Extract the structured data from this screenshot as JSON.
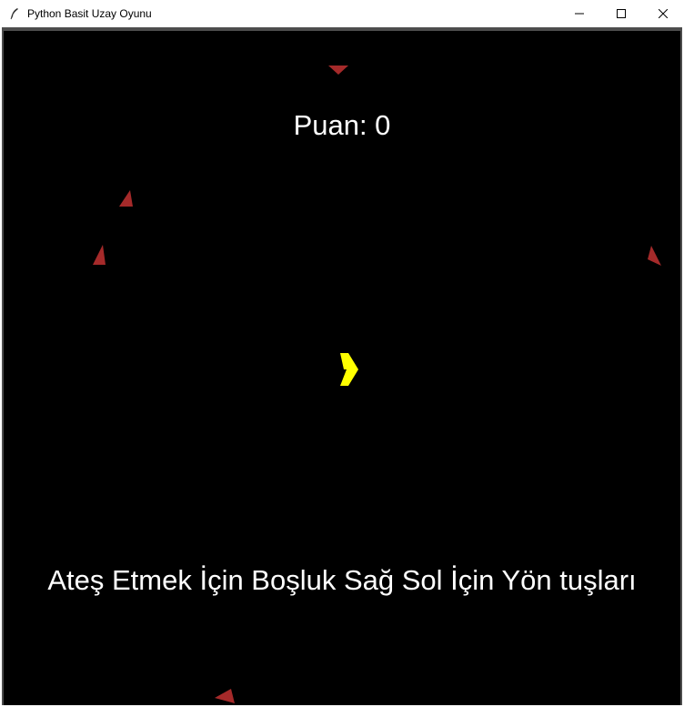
{
  "window": {
    "title": "Python Basit Uzay Oyunu",
    "icon": "feather-icon",
    "controls": [
      "minimize-icon",
      "maximize-icon",
      "close-icon"
    ]
  },
  "game": {
    "score_text": "Puan: 0",
    "instructions": "Ateş Etmek İçin Boşluk Sağ Sol İçin Yön tuşları",
    "colors": {
      "background": "#000000",
      "player": "#ffff00",
      "enemy": "#a52a2a",
      "text": "#ffffff"
    },
    "player_icon": "player-ship-icon",
    "enemy_icon": "enemy-ship-icon"
  }
}
